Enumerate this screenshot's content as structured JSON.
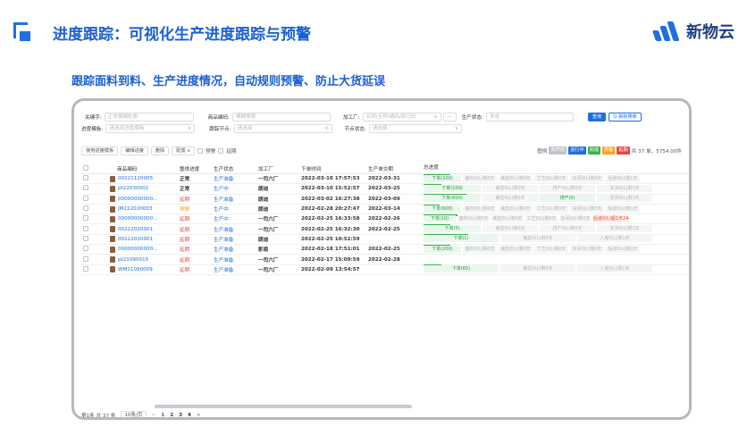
{
  "slide": {
    "title": "进度跟踪：可视化生产进度跟踪与预警",
    "subtitle": "跟踪面料到料、生产进度情况，自动规则预警、防止大货延误",
    "logo_text": "新物云",
    "accent": "#1f6fe0"
  },
  "filters": {
    "keyword_label": "关键字:",
    "keyword_placeholder": "正常模糊检索",
    "product_code_label": "商品编码:",
    "product_code_placeholder": "模糊搜索",
    "factory_label": "加工厂:",
    "factory_placeholder": "名称/全称/编码/助记码",
    "more_button": "···",
    "prod_status_label": "生产状态:",
    "prod_status_placeholder": "多选",
    "template_label": "进度模板:",
    "template_placeholder": "请选择进度模板",
    "follow_node_label": "跟踪节点:",
    "follow_node_placeholder": "请选择",
    "node_status_label": "节点状态:",
    "node_status_placeholder": "请选择",
    "search_button": "查询",
    "advanced_button": "Q 高级搜索"
  },
  "toolbar": {
    "template_btn": "使用进度模板",
    "edit_btn": "编辑进度",
    "delete_btn": "删除",
    "config_btn": "配置 ∨",
    "warn_label": "预警",
    "late_label": "延期"
  },
  "legend": {
    "label": "图例",
    "items": [
      {
        "text": "未开始",
        "color": "#c0c4cc"
      },
      {
        "text": "进行中",
        "color": "#1f6fe0"
      },
      {
        "text": "完成",
        "color": "#39b54a"
      },
      {
        "text": "预警",
        "color": "#f5a623"
      },
      {
        "text": "延期",
        "color": "#e8453c"
      }
    ],
    "total": "共 37 单，5754.00件"
  },
  "table": {
    "headers": [
      "商品编码",
      "整体进度",
      "生产状态",
      "加工厂",
      "下单时间",
      "生产单交期",
      "总进度"
    ],
    "rows": [
      {
        "code": "00221120005",
        "overall": "正常",
        "ostyle": "normal",
        "status": "生产准备",
        "factory": "一司六厂",
        "time": "2022-03-10 17:57:53",
        "due": "2022-03-31",
        "segs": [
          {
            "t": "下单(100)",
            "s": "done",
            "w": 44
          },
          {
            "t": "备料0(L)剩0天",
            "s": "pend",
            "w": 40
          },
          {
            "t": "裁剪0(L)剩0天",
            "s": "pend",
            "w": 40
          },
          {
            "t": "工艺0(L)剩0天",
            "s": "pend",
            "w": 40
          },
          {
            "t": "车间0(L)剩0天",
            "s": "pend",
            "w": 40
          },
          {
            "t": "后道0(L)剩1天",
            "s": "pend",
            "w": 40
          }
        ],
        "bar": 30
      },
      {
        "code": "pt22030002",
        "overall": "正常",
        "ostyle": "normal",
        "status": "生产中",
        "factory": "朗迪",
        "time": "2022-03-10 15:52:57",
        "due": "2022-03-25",
        "segs": [
          {
            "t": "下单(100)",
            "s": "done",
            "w": 66
          },
          {
            "t": "裁剪0(L)剩0天",
            "s": "pend",
            "w": 64
          },
          {
            "t": "排产0(L)剩0天",
            "s": "pend",
            "w": 64
          },
          {
            "t": "发货0(L)剩1天",
            "s": "pend",
            "w": 64
          }
        ],
        "bar": 20
      },
      {
        "code": "00000000000...",
        "overall": "延期",
        "ostyle": "late",
        "status": "生产准备",
        "factory": "朗迪",
        "time": "2022-03-02 16:27:38",
        "due": "2022-03-09",
        "segs": [
          {
            "t": "下单(600)",
            "s": "done",
            "w": 66
          },
          {
            "t": "裁剪0(L)剩0天",
            "s": "pend",
            "w": 64
          },
          {
            "t": "排产(0)",
            "s": "done",
            "w": 64
          },
          {
            "t": "发货0(L)剩1天",
            "s": "pend",
            "w": 64
          }
        ],
        "bar": 48
      },
      {
        "code": "JM222020003",
        "overall": "预警",
        "ostyle": "warn",
        "status": "生产中",
        "factory": "朗迪",
        "time": "2022-02-28 20:27:47",
        "due": "2022-03-14",
        "segs": [
          {
            "t": "下单(600)",
            "s": "done",
            "w": 44
          },
          {
            "t": "备料0(L)剩0天",
            "s": "pend",
            "w": 40
          },
          {
            "t": "裁剪0(L)剩0天",
            "s": "pend",
            "w": 40
          },
          {
            "t": "工艺0(L)剩0天",
            "s": "pend",
            "w": 40
          },
          {
            "t": "车间0(L)剩0天",
            "s": "pend",
            "w": 40
          },
          {
            "t": "后道0(L)剩1天",
            "s": "pend",
            "w": 40
          }
        ],
        "bar": 18
      },
      {
        "code": "00000000000...",
        "overall": "延期",
        "ostyle": "late",
        "status": "生产中",
        "factory": "一司六厂",
        "time": "2022-02-25 16:33:58",
        "due": "2022-02-26",
        "segs": [
          {
            "t": "下单(10)",
            "s": "done",
            "w": 38
          },
          {
            "t": "备料0(L)剩0天",
            "s": "pend",
            "w": 38
          },
          {
            "t": "裁剪0(L)剩0天",
            "s": "pend",
            "w": 38
          },
          {
            "t": "工艺0(L)剩0天",
            "s": "pend",
            "w": 38
          },
          {
            "t": "车间0(L)剩0天",
            "s": "pend",
            "w": 38
          },
          {
            "t": "后道0(L)超1天24小",
            "s": "late",
            "w": 42
          }
        ],
        "bar": 38
      },
      {
        "code": "00222020001",
        "overall": "延期",
        "ostyle": "late",
        "status": "生产准备",
        "factory": "一司六厂",
        "time": "2022-02-25 16:32:30",
        "due": "2022-02-25",
        "segs": [
          {
            "t": "下单(5)",
            "s": "done",
            "w": 66
          },
          {
            "t": "裁剪0(L)剩0天",
            "s": "pend",
            "w": 64
          },
          {
            "t": "排产0(L)剩0天",
            "s": "pend",
            "w": 64
          },
          {
            "t": "发货0(L)剩1天",
            "s": "pend",
            "w": 64
          }
        ],
        "bar": 30
      },
      {
        "code": "00222020001",
        "overall": "延期",
        "ostyle": "late",
        "status": "生产准备",
        "factory": "朗迪",
        "time": "2022-02-25 10:52:59",
        "due": "",
        "segs": [
          {
            "t": "下单(1)",
            "s": "done",
            "w": 86
          },
          {
            "t": "裁剪0(L)剩0天",
            "s": "pend",
            "w": 86
          },
          {
            "t": "入库0(L)剩1天",
            "s": "pend",
            "w": 86
          }
        ],
        "bar": 50
      },
      {
        "code": "00000000000...",
        "overall": "延期",
        "ostyle": "late",
        "status": "生产准备",
        "factory": "影南",
        "time": "2022-02-18 17:51:01",
        "due": "2022-02-25",
        "segs": [
          {
            "t": "下单(200)",
            "s": "done",
            "w": 44
          },
          {
            "t": "备料0(L)剩0天",
            "s": "pend",
            "w": 40
          },
          {
            "t": "裁剪0(L)剩0天",
            "s": "pend",
            "w": 40
          },
          {
            "t": "工艺0(L)剩0天",
            "s": "pend",
            "w": 40
          },
          {
            "t": "车间0(L)剩0天",
            "s": "pend",
            "w": 40
          },
          {
            "t": "后道0(L)剩1天",
            "s": "pend",
            "w": 40
          }
        ],
        "bar": 30
      },
      {
        "code": "pt21090015",
        "overall": "延期",
        "ostyle": "late",
        "status": "生产准备",
        "factory": "一司六厂",
        "time": "2022-02-17 15:09:59",
        "due": "2022-02-28",
        "segs": [],
        "bar": 0
      },
      {
        "code": "WM21090009",
        "overall": "延期",
        "ostyle": "late",
        "status": "生产准备",
        "factory": "一司六厂",
        "time": "2022-02-09 13:54:57",
        "due": "",
        "segs": [
          {
            "t": "下单(65)",
            "s": "done",
            "w": 86
          },
          {
            "t": "裁剪0(L)剩0天",
            "s": "pend",
            "w": 86
          },
          {
            "t": "入库0(L)剩1天",
            "s": "pend",
            "w": 86
          }
        ],
        "bar": 20
      }
    ]
  },
  "pagination": {
    "info": "第1条 共 37 条",
    "page_size": "10条/页",
    "prev": "<",
    "pages": [
      "1",
      "2",
      "3",
      "4"
    ],
    "next": ">"
  }
}
